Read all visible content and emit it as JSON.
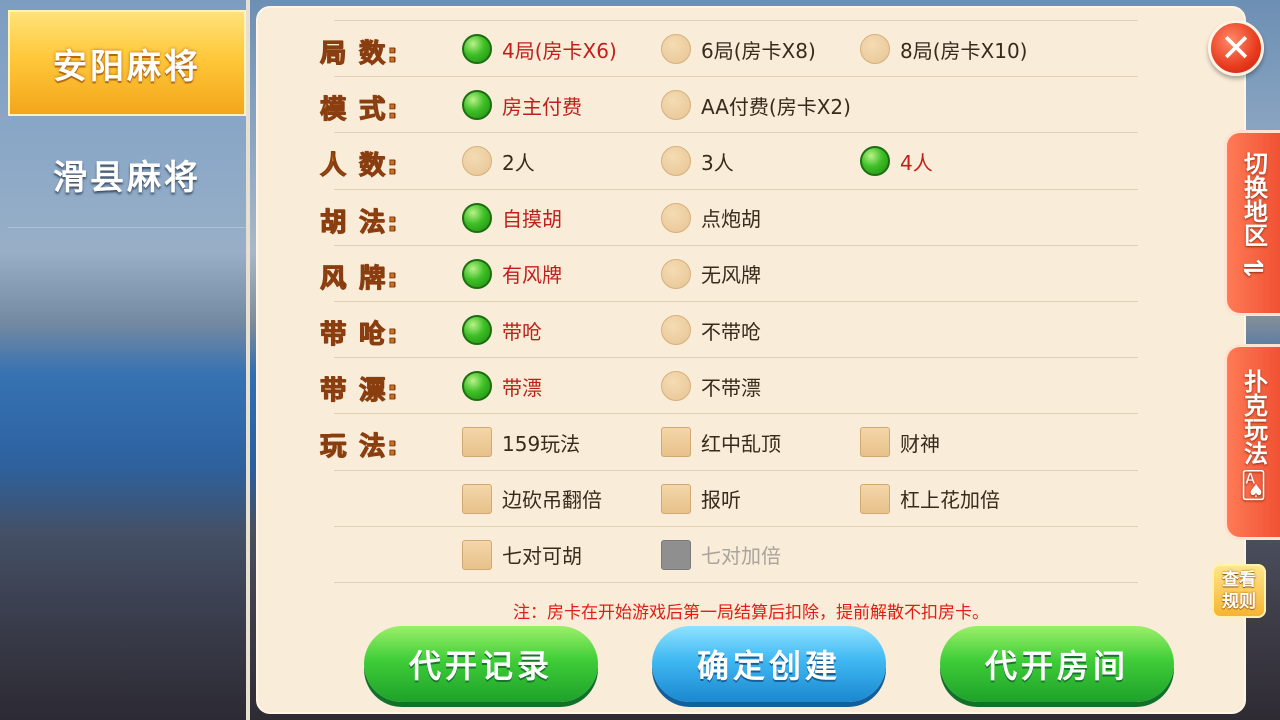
{
  "tabs": [
    {
      "label": "安阳麻将",
      "active": true
    },
    {
      "label": "滑县麻将",
      "active": false
    }
  ],
  "rows": [
    {
      "label": "局 数:",
      "type": "radio",
      "options": [
        {
          "text": "4局(房卡X6)",
          "selected": true
        },
        {
          "text": "6局(房卡X8)",
          "selected": false
        },
        {
          "text": "8局(房卡X10)",
          "selected": false
        }
      ]
    },
    {
      "label": "模 式:",
      "type": "radio",
      "options": [
        {
          "text": "房主付费",
          "selected": true
        },
        {
          "text": "AA付费(房卡X2)",
          "selected": false
        }
      ]
    },
    {
      "label": "人 数:",
      "type": "radio",
      "options": [
        {
          "text": "2人",
          "selected": false
        },
        {
          "text": "3人",
          "selected": false
        },
        {
          "text": "4人",
          "selected": true
        }
      ]
    },
    {
      "label": "胡 法:",
      "type": "radio",
      "options": [
        {
          "text": "自摸胡",
          "selected": true
        },
        {
          "text": "点炮胡",
          "selected": false
        }
      ]
    },
    {
      "label": "风 牌:",
      "type": "radio",
      "options": [
        {
          "text": "有风牌",
          "selected": true
        },
        {
          "text": "无风牌",
          "selected": false
        }
      ]
    },
    {
      "label": "带 呛:",
      "type": "radio",
      "options": [
        {
          "text": "带呛",
          "selected": true
        },
        {
          "text": "不带呛",
          "selected": false
        }
      ]
    },
    {
      "label": "带 漂:",
      "type": "radio",
      "options": [
        {
          "text": "带漂",
          "selected": true
        },
        {
          "text": "不带漂",
          "selected": false
        }
      ]
    },
    {
      "label": "玩 法:",
      "type": "check",
      "options": [
        {
          "text": "159玩法",
          "checked": false
        },
        {
          "text": "红中乱顶",
          "checked": false
        },
        {
          "text": "财神",
          "checked": false
        }
      ]
    },
    {
      "label": "",
      "type": "check",
      "options": [
        {
          "text": "边砍吊翻倍",
          "checked": false
        },
        {
          "text": "报听",
          "checked": false
        },
        {
          "text": "杠上花加倍",
          "checked": false
        }
      ]
    },
    {
      "label": "",
      "type": "check",
      "options": [
        {
          "text": "七对可胡",
          "checked": false
        },
        {
          "text": "七对加倍",
          "checked": false,
          "disabled": true
        }
      ]
    }
  ],
  "note": "注：房卡在开始游戏后第一局结算后扣除，提前解散不扣房卡。",
  "buttons": {
    "proxy_record": "代开记录",
    "confirm_create": "确定创建",
    "proxy_room": "代开房间"
  },
  "close_icon": "✕",
  "side_tabs": {
    "switch_region": "切换地区",
    "switch_icon": "⇌",
    "poker_play": "扑克玩法",
    "poker_icon": "🂡"
  },
  "rules_button": {
    "line1": "查看",
    "line2": "规则"
  },
  "colors": {
    "selected_text": "#c0201b",
    "label": "#c9731d",
    "note": "#e01e12"
  }
}
